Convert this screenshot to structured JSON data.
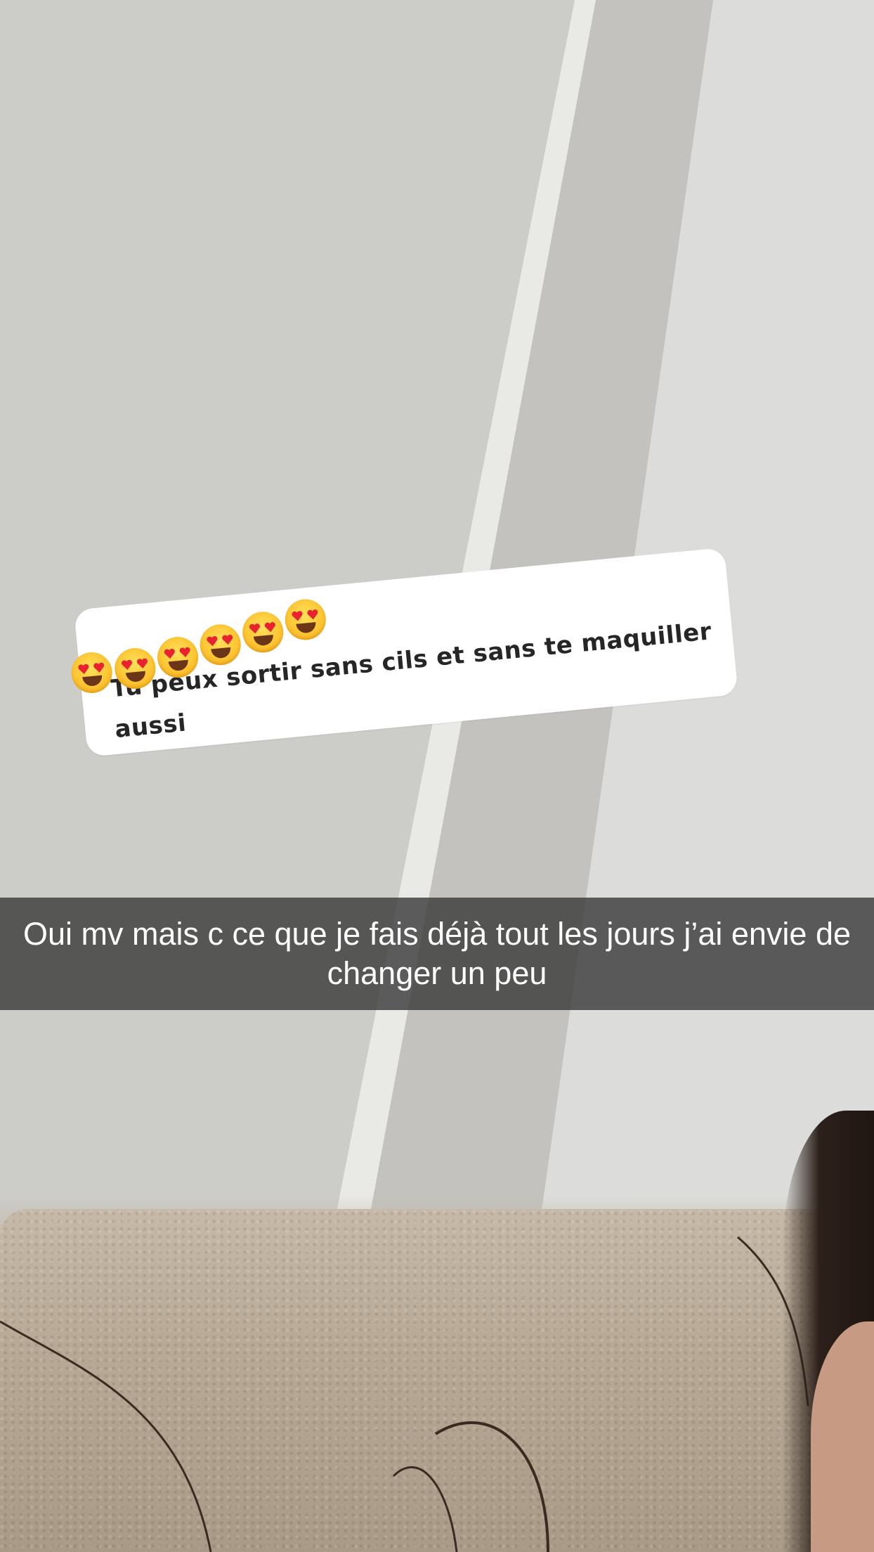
{
  "question_sticker": {
    "username": "",
    "question": "Tu peux sortir sans cils et sans te maquiller aussi",
    "reaction_icons": [
      "heart-eyes-emoji",
      "heart-eyes-emoji",
      "heart-eyes-emoji",
      "heart-eyes-emoji",
      "heart-eyes-emoji",
      "heart-eyes-emoji"
    ]
  },
  "caption": {
    "text": "Oui mv mais c ce que je fais déjà tout les jours j’ai envie de changer un peu"
  },
  "colors": {
    "caption_bar": "#3c3c3c",
    "sticker_bg": "#ffffff",
    "username_accent": "#1da1f2"
  }
}
